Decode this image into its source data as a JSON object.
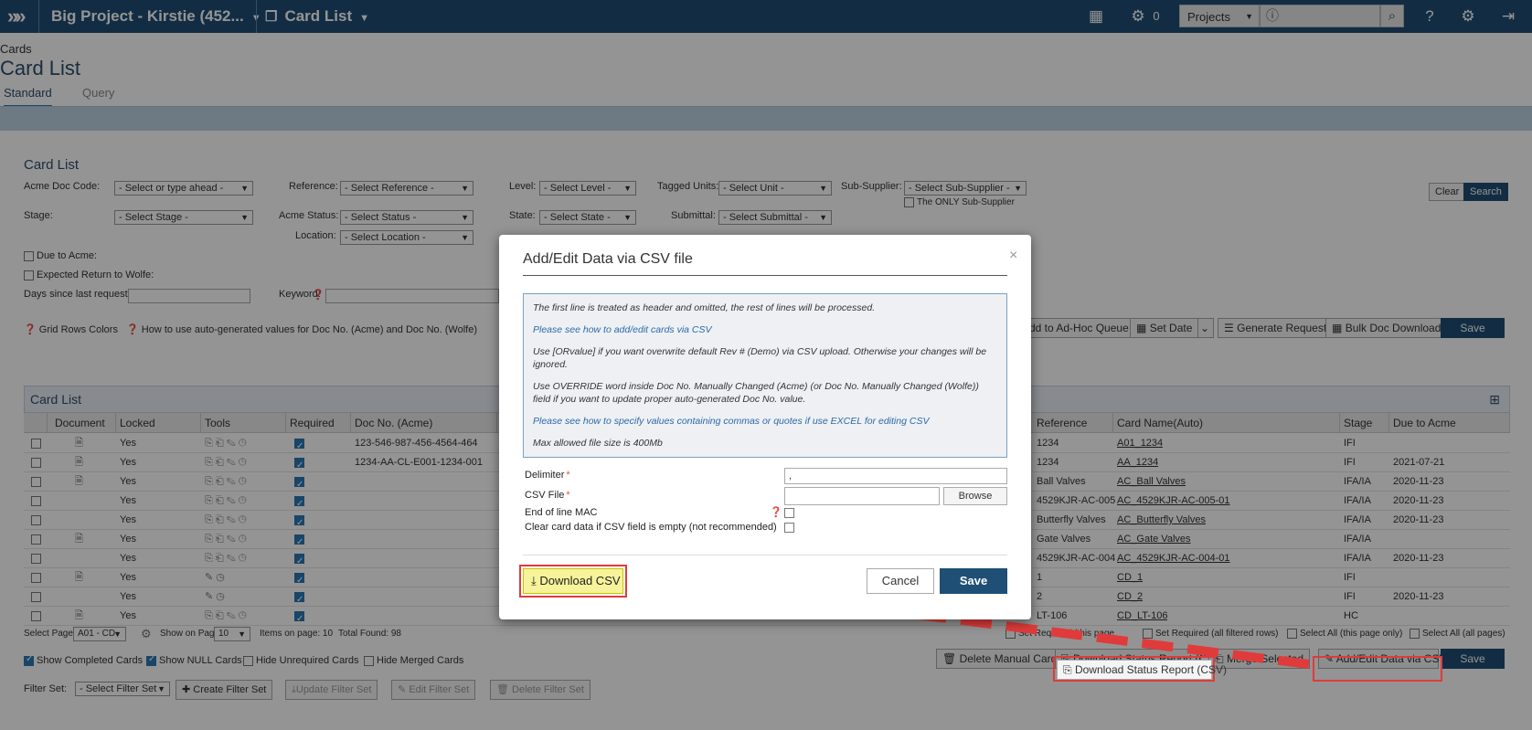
{
  "topbar": {
    "project": "Big Project - Kirstie (452...",
    "view": "Card List",
    "gears_count": "0",
    "projects_select": "Projects",
    "search_icon": "magnifier-icon"
  },
  "page": {
    "breadcrumb": "Cards",
    "title": "Card List",
    "tabs": [
      "Standard",
      "Query"
    ]
  },
  "filters": {
    "section_title": "Card List",
    "acme_doc_code_label": "Acme Doc Code:",
    "acme_doc_code_value": "- Select or type ahead -",
    "reference_label": "Reference:",
    "reference_value": "- Select Reference -",
    "level_label": "Level:",
    "level_value": "- Select Level -",
    "tagged_units_label": "Tagged Units:",
    "tagged_units_value": "- Select Unit -",
    "sub_supplier_label": "Sub-Supplier:",
    "sub_supplier_value": "- Select Sub-Supplier -",
    "only_sub_supplier": "The ONLY Sub-Supplier",
    "stage_label": "Stage:",
    "stage_value": "- Select Stage -",
    "acme_status_label": "Acme Status:",
    "acme_status_value": "- Select Status -",
    "state_label": "State:",
    "state_value": "- Select State -",
    "submittal_label": "Submittal:",
    "submittal_value": "- Select Submittal -",
    "location_label": "Location:",
    "location_value": "- Select Location -",
    "due_to_acme": "Due to Acme:",
    "expected_return": "Expected Return to Wolfe:",
    "days_since": "Days since last request:",
    "keyword": "Keyword:",
    "clear": "Clear",
    "search": "Search"
  },
  "toolbar": {
    "grid_rows_colors": "Grid Rows Colors",
    "how_to_auto": "How to use auto-generated values for Doc No. (Acme) and Doc No. (Wolfe)",
    "add_adhoc": "dd to Ad-Hoc Queue",
    "set_date": "Set Date",
    "generate_request": "Generate Request",
    "bulk_download": "Bulk Doc Download",
    "save": "Save"
  },
  "grid": {
    "title": "Card List",
    "columns_left": [
      "Document",
      "Locked",
      "Tools",
      "Required",
      "Doc No. (Acme)"
    ],
    "columns_right": [
      "Reference",
      "Card Name(Auto)",
      "Stage",
      "Due to Acme"
    ],
    "rows": [
      {
        "locked": "Yes",
        "doc": "123-546-987-456-4564-464",
        "ref": "1234",
        "name": "A01_1234",
        "stage": "IFI",
        "due": ""
      },
      {
        "locked": "Yes",
        "doc": "1234-AA-CL-E001-1234-001",
        "ref": "1234",
        "name": "AA_1234",
        "stage": "IFI",
        "due": "2021-07-21"
      },
      {
        "locked": "Yes",
        "doc": "",
        "ref": "Ball Valves",
        "name": "AC_Ball Valves",
        "stage": "IFA/IA",
        "due": "2020-11-23"
      },
      {
        "locked": "Yes",
        "doc": "",
        "ref": "4529KJR-AC-005",
        "name": "AC_4529KJR-AC-005-01",
        "stage": "IFA/IA",
        "due": "2020-11-23"
      },
      {
        "locked": "Yes",
        "doc": "",
        "ref": "Butterfly Valves",
        "name": "AC_Butterfly Valves",
        "stage": "IFA/IA",
        "due": "2020-11-23"
      },
      {
        "locked": "Yes",
        "doc": "",
        "ref": "Gate Valves",
        "name": "AC_Gate Valves",
        "stage": "IFA/IA",
        "due": ""
      },
      {
        "locked": "Yes",
        "doc": "",
        "ref": "4529KJR-AC-004",
        "name": "AC_4529KJR-AC-004-01",
        "stage": "IFA/IA",
        "due": "2020-11-23"
      },
      {
        "locked": "Yes",
        "doc": "",
        "ref": "1",
        "name": "CD_1",
        "stage": "IFI",
        "due": ""
      },
      {
        "locked": "Yes",
        "doc": "",
        "ref": "2",
        "name": "CD_2",
        "stage": "IFI",
        "due": "2020-11-23"
      },
      {
        "locked": "Yes",
        "doc": "",
        "ref": "LT-106",
        "name": "CD_LT-106",
        "stage": "HC",
        "due": ""
      }
    ]
  },
  "pager": {
    "select_page": "Select Page:",
    "page_value": "A01 - CD",
    "show_on_page": "Show on Page:",
    "show_value": "10",
    "items_on_page": "Items on page: 10",
    "total_found": "Total Found: 98",
    "set_required_page": "Set Required (this page",
    "set_required_all": "Set Required (all filtered rows)",
    "select_all_page": "Select All (this page only)",
    "select_all_pages": "Select All (all pages)"
  },
  "bottom": {
    "show_completed": "Show Completed Cards",
    "show_null": "Show NULL Cards",
    "hide_unrequired": "Hide Unrequired Cards",
    "hide_merged": "Hide Merged Cards",
    "delete_manual": "Delete Manual Cards",
    "download_status": "Download Status Report (CSV)",
    "merge_selected": "Merge Selected",
    "add_edit_csv": "Add/Edit Data via CSV",
    "save": "Save",
    "filter_set": "Filter Set:",
    "filter_set_value": "- Select Filter Set -",
    "create_filter": "Create Filter Set",
    "update_filter": "Update Filter Set",
    "edit_filter": "Edit Filter Set",
    "delete_filter": "Delete Filter Set"
  },
  "modal": {
    "title": "Add/Edit Data via CSV file",
    "close": "×",
    "info": [
      "The first line is treated as header and omitted, the rest of lines will be processed.",
      "Please see how to add/edit cards via CSV",
      "Use [ORvalue] if you want overwrite default Rev # (Demo) via CSV upload. Otherwise your changes will be ignored.",
      "Use OVERRIDE word inside Doc No. Manually Changed (Acme) (or Doc No. Manually Changed (Wolfe)) field if you want to update proper auto-generated Doc No. value.",
      "Please see how to specify values containing commas or quotes if use EXCEL for editing CSV",
      "Max allowed file size is 400Mb"
    ],
    "delimiter_label": "Delimiter",
    "delimiter_value": ",",
    "csv_file_label": "CSV File",
    "browse": "Browse",
    "eol_mac_label": "End of line MAC",
    "clear_data_label": "Clear card data if CSV field is empty (not recommended)",
    "download_csv": "Download CSV",
    "cancel": "Cancel",
    "save": "Save"
  },
  "colors": {
    "topbar": "#1f4f74",
    "accent": "#2b77b5",
    "highlight": "#f7f39a",
    "annotation": "#e03b3b"
  }
}
